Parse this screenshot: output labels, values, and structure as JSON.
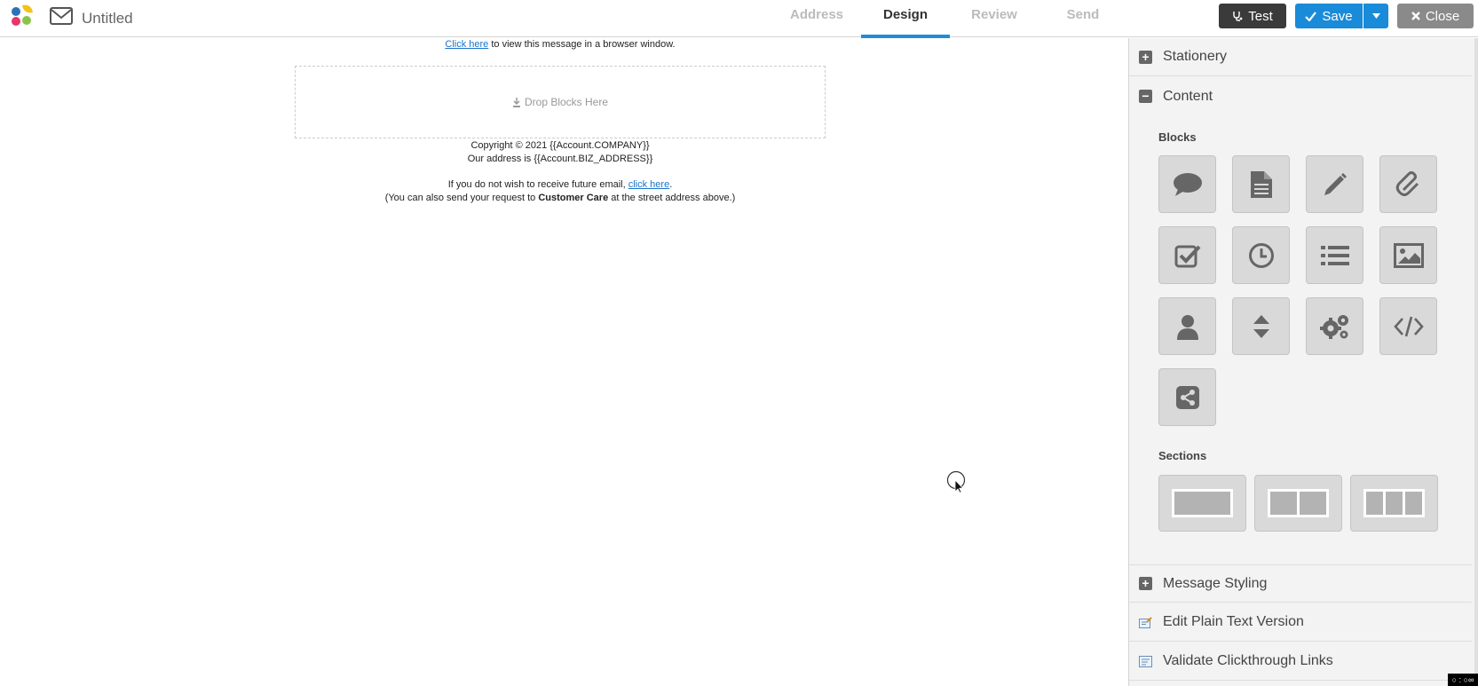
{
  "header": {
    "title": "Untitled",
    "steps": [
      {
        "label": "Address"
      },
      {
        "label": "Design"
      },
      {
        "label": "Review"
      },
      {
        "label": "Send"
      }
    ],
    "test_label": "Test",
    "save_label": "Save",
    "close_label": "Close"
  },
  "canvas": {
    "browser_link": "Click here",
    "browser_rest": " to view this message in a browser window.",
    "dropzone_label": "Drop Blocks Here",
    "copyright": "Copyright © 2021 {{Account.COMPANY}}",
    "address": "Our address is {{Account.BIZ_ADDRESS}}",
    "unsub_before": "If you do not wish to receive future email, ",
    "unsub_link": "click here",
    "unsub_after": ".",
    "care_before": "(You can also send your request to ",
    "care_bold": "Customer Care",
    "care_after": " at the street address above.)"
  },
  "panel": {
    "stationery": "Stationery",
    "content": "Content",
    "blocks_label": "Blocks",
    "sections_label": "Sections",
    "message_styling": "Message Styling",
    "edit_plain_text": "Edit Plain Text Version",
    "validate_links": "Validate Clickthrough Links",
    "blocks": [
      {
        "icon": "speech-bubble-icon"
      },
      {
        "icon": "document-icon"
      },
      {
        "icon": "pencil-icon"
      },
      {
        "icon": "paperclip-icon"
      },
      {
        "icon": "checkbox-icon"
      },
      {
        "icon": "clock-icon"
      },
      {
        "icon": "list-icon"
      },
      {
        "icon": "image-icon"
      },
      {
        "icon": "person-icon"
      },
      {
        "icon": "spacer-icon"
      },
      {
        "icon": "gears-icon"
      },
      {
        "icon": "code-icon"
      },
      {
        "icon": "share-icon"
      }
    ],
    "sections": [
      {
        "columns": 1
      },
      {
        "columns": 2
      },
      {
        "columns": 3
      }
    ]
  },
  "colors": {
    "accent": "#1a8bd8",
    "tile": "#d9d9d9",
    "icon": "#666666"
  }
}
